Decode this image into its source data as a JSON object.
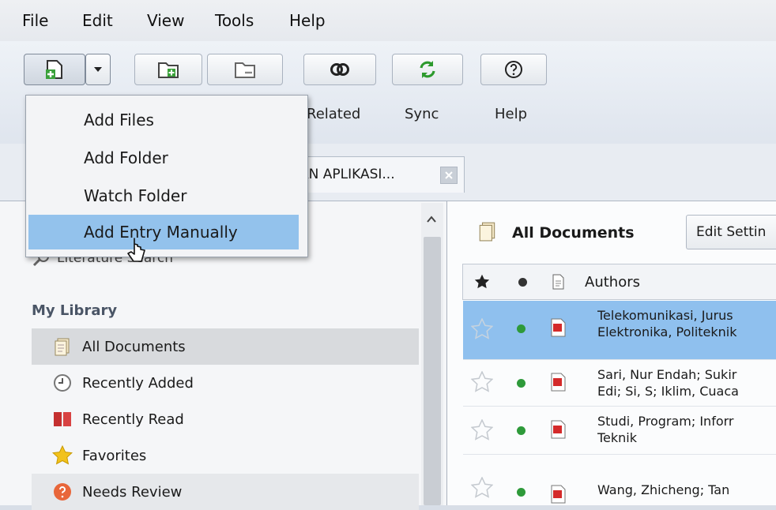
{
  "menubar": {
    "file": "File",
    "edit": "Edit",
    "view": "View",
    "tools": "Tools",
    "help": "Help"
  },
  "toolbar": {
    "related_label": "Related",
    "sync_label": "Sync",
    "help_label": "Help"
  },
  "add_menu": {
    "items": [
      "Add Files",
      "Add Folder",
      "Watch Folder",
      "Add Entry Manually"
    ],
    "highlighted": "Add Entry Manually"
  },
  "tab": {
    "label": "AN APLIKASI..."
  },
  "sidebar": {
    "literature_search": "Literature Search",
    "section_title": "My Library",
    "items": [
      "All Documents",
      "Recently Added",
      "Recently Read",
      "Favorites",
      "Needs Review"
    ]
  },
  "main": {
    "title": "All Documents",
    "edit_settings": "Edit Settin",
    "columns": {
      "authors": "Authors"
    },
    "rows": [
      {
        "authors_line1": "Telekomunikasi, Jurus",
        "authors_line2": "Elektronika, Politeknik"
      },
      {
        "authors_line1": "Sari, Nur Endah; Sukir",
        "authors_line2": "Edi; Si, S; Iklim, Cuaca"
      },
      {
        "authors_line1": "Studi, Program; Inforr",
        "authors_line2": "Teknik"
      },
      {
        "authors_line1": "Wang, Zhicheng; Tan",
        "authors_line2": ""
      }
    ]
  },
  "colors": {
    "selection": "#8fc0ee",
    "menu_highlight": "#93c2ec",
    "read_dot": "#2e9a3a",
    "pdf_red": "#d42a2a"
  }
}
